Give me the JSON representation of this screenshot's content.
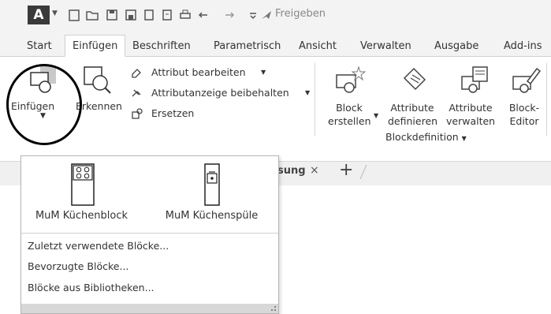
{
  "app": {
    "logo_letter": "A",
    "share_label": "Freigeben"
  },
  "tabs": [
    "Start",
    "Einfügen",
    "Beschriften",
    "Parametrisch",
    "Ansicht",
    "Verwalten",
    "Ausgabe",
    "Add-ins"
  ],
  "ribbon": {
    "insert_label": "Einfügen",
    "recognize_label": "Erkennen",
    "edit_attribute": "Attribut bearbeiten",
    "keep_attribute_display": "Attributanzeige beibehalten",
    "replace": "Ersetzen",
    "create_block": [
      "Block",
      "erstellen"
    ],
    "define_attributes": [
      "Attribute",
      "definieren"
    ],
    "manage_attributes": [
      "Attribute",
      "verwalten"
    ],
    "block_editor": [
      "Block-",
      "Editor"
    ],
    "panel_block_definition": "Blockdefinition"
  },
  "docbar": {
    "tab_fragment": "sung",
    "close_glyph": "×",
    "new_tab_glyph": "+"
  },
  "dropdown": {
    "blocks": [
      {
        "label": "MuM Küchenblock",
        "icon": "kitchen-block-icon"
      },
      {
        "label": "MuM Küchenspüle",
        "icon": "kitchen-sink-icon"
      }
    ],
    "items": [
      "Zuletzt verwendete Blöcke...",
      "Bevorzugte Blöcke...",
      "Blöcke aus Bibliotheken..."
    ]
  },
  "colors": {
    "toolbar_bg": "#f3f3f3",
    "logo_bg": "#3a3a3a",
    "highlight_circle": "#000000"
  }
}
